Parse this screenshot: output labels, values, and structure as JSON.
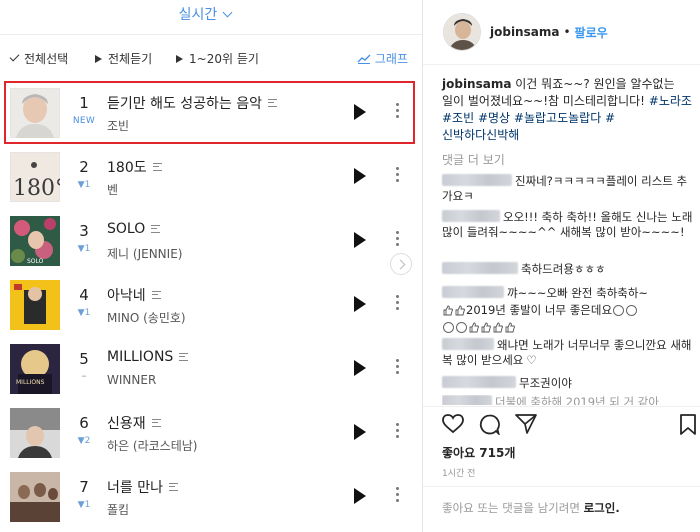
{
  "chart_app": {
    "tab_label": "실시간",
    "toolbar": {
      "select_all": "전체선택",
      "play_all": "전체듣기",
      "play_top": "1~20위 듣기",
      "graph": "그래프"
    },
    "rows": [
      {
        "rank": "1",
        "change": "NEW",
        "title": "듣기만 해도 성공하는 음악",
        "artist": "조빈"
      },
      {
        "rank": "2",
        "change": "▼1",
        "title": "180도",
        "artist": "벤"
      },
      {
        "rank": "3",
        "change": "▼1",
        "title": "SOLO",
        "artist": "제니 (JENNIE)"
      },
      {
        "rank": "4",
        "change": "▼1",
        "title": "아낙네",
        "artist": "MINO (송민호)"
      },
      {
        "rank": "5",
        "change": "–",
        "title": "MILLIONS",
        "artist": "WINNER"
      },
      {
        "rank": "6",
        "change": "▼2",
        "title": "신용재",
        "artist": "하은 (라코스테남)"
      },
      {
        "rank": "7",
        "change": "▼1",
        "title": "너를 만나",
        "artist": "폴킴"
      }
    ],
    "cover_art": {
      "row2": "180°",
      "row5": "MILLIONS",
      "row3": "SOLO"
    },
    "colors": {
      "accent": "#4a90e2",
      "highlight": "#e0262a"
    }
  },
  "instagram": {
    "username": "jobinsama",
    "dot": "•",
    "follow": "팔로우",
    "caption": {
      "user": "jobinsama",
      "text": " 이건 뭐죠~~? 원인을 알수없는 일이 벌어졌네요~~!참 미스테리합니다!",
      "tags": "#노라조 #조빈 #명상 #놀랍고도놀랍다 #신박하다신박해"
    },
    "more_comments": "댓글 더 보기",
    "comments": [
      "진짜네?ㅋㅋㅋㅋㅋ플레이 리스트 추가요ㅋ",
      "오오!!! 축하 축하!! 올해도 신나는 노래 많이 들려줘~~~~^^ 새해복 많이 받아~~~~!",
      "축하드려용ㅎㅎㅎ",
      "꺄~~~오빠 완전 축하축하~",
      "2019년 좋발이 너무 좋은데요",
      "왜냐면 노래가 너무너무 좋으니깐요 새해 복 많이 받으세요",
      "무조권이야",
      "더불에 축하해 2019년 되 거 같아"
    ],
    "likes": "좋아요 715개",
    "time": "1시간 전",
    "login_prompt": "좋아요 또는 댓글을 남기려면 ",
    "login_link": "로그인."
  }
}
